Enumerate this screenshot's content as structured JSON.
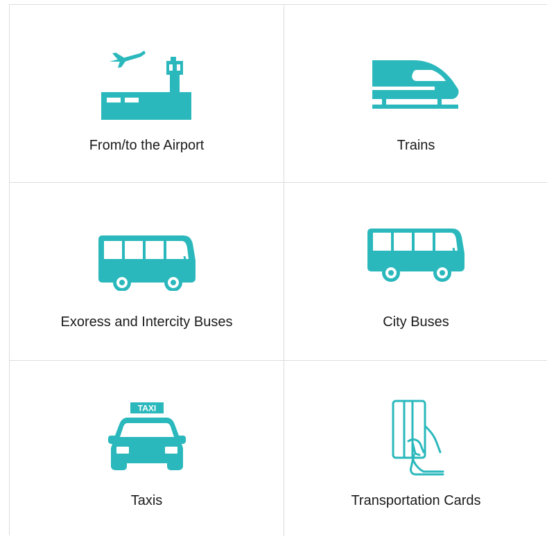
{
  "brand_color": "#2ab8bc",
  "tiles": [
    {
      "label": "From/to the Airport",
      "icon": "airport-icon"
    },
    {
      "label": "Trains",
      "icon": "train-icon"
    },
    {
      "label": "Exoress and Intercity Buses",
      "icon": "bus-icon"
    },
    {
      "label": "City Buses",
      "icon": "city-bus-icon"
    },
    {
      "label": "Taxis",
      "icon": "taxi-icon"
    },
    {
      "label": "Transportation Cards",
      "icon": "transportation-card-icon"
    }
  ],
  "taxi_sign": "TAXI"
}
